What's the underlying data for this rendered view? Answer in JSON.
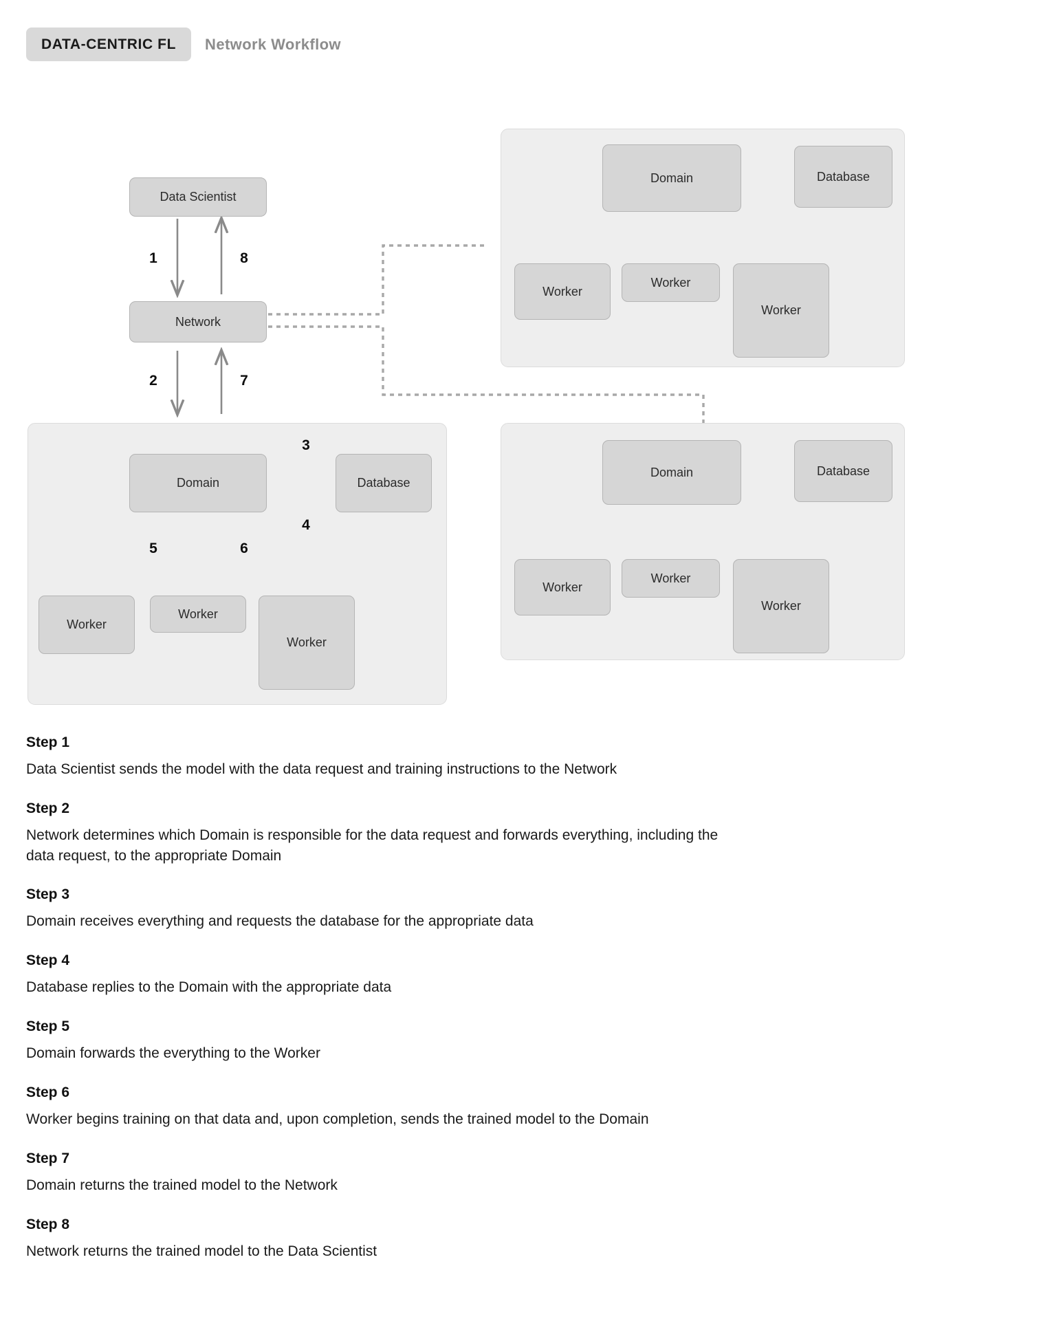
{
  "header": {
    "badge": "DATA-CENTRIC FL",
    "subtitle": "Network Workflow"
  },
  "diagram": {
    "nodes": {
      "data_scientist": "Data Scientist",
      "network": "Network",
      "domain": "Domain",
      "database": "Database",
      "worker": "Worker"
    },
    "edge_labels": {
      "e1": "1",
      "e2": "2",
      "e3": "3",
      "e4": "4",
      "e5": "5",
      "e6": "6",
      "e7": "7",
      "e8": "8"
    },
    "colors": {
      "node_fill": "#d6d6d6",
      "node_border": "#b4b4b4",
      "panel_fill": "#eeeeee",
      "panel_border": "#dcdcdc",
      "arrow": "#8a8a8a",
      "dotted": "#a8a8a8",
      "badge_fill": "#d9d9d9",
      "subtitle_color": "#8c8c8c"
    }
  },
  "steps": [
    {
      "title": "Step 1",
      "body": "Data Scientist sends the model with the data request and training instructions to the Network"
    },
    {
      "title": "Step 2",
      "body": "Network determines which Domain is responsible for the data request and forwards everything, including the data request, to the appropriate Domain"
    },
    {
      "title": "Step 3",
      "body": "Domain receives everything and requests the database for the appropriate data"
    },
    {
      "title": "Step 4",
      "body": "Database replies to the Domain with the appropriate data"
    },
    {
      "title": "Step 5",
      "body": "Domain forwards the everything to the Worker"
    },
    {
      "title": "Step 6",
      "body": "Worker begins training on that data and, upon completion, sends the trained model to the Domain"
    },
    {
      "title": "Step 7",
      "body": "Domain returns the trained model to the Network"
    },
    {
      "title": "Step 8",
      "body": "Network returns the trained model to the Data Scientist"
    }
  ]
}
